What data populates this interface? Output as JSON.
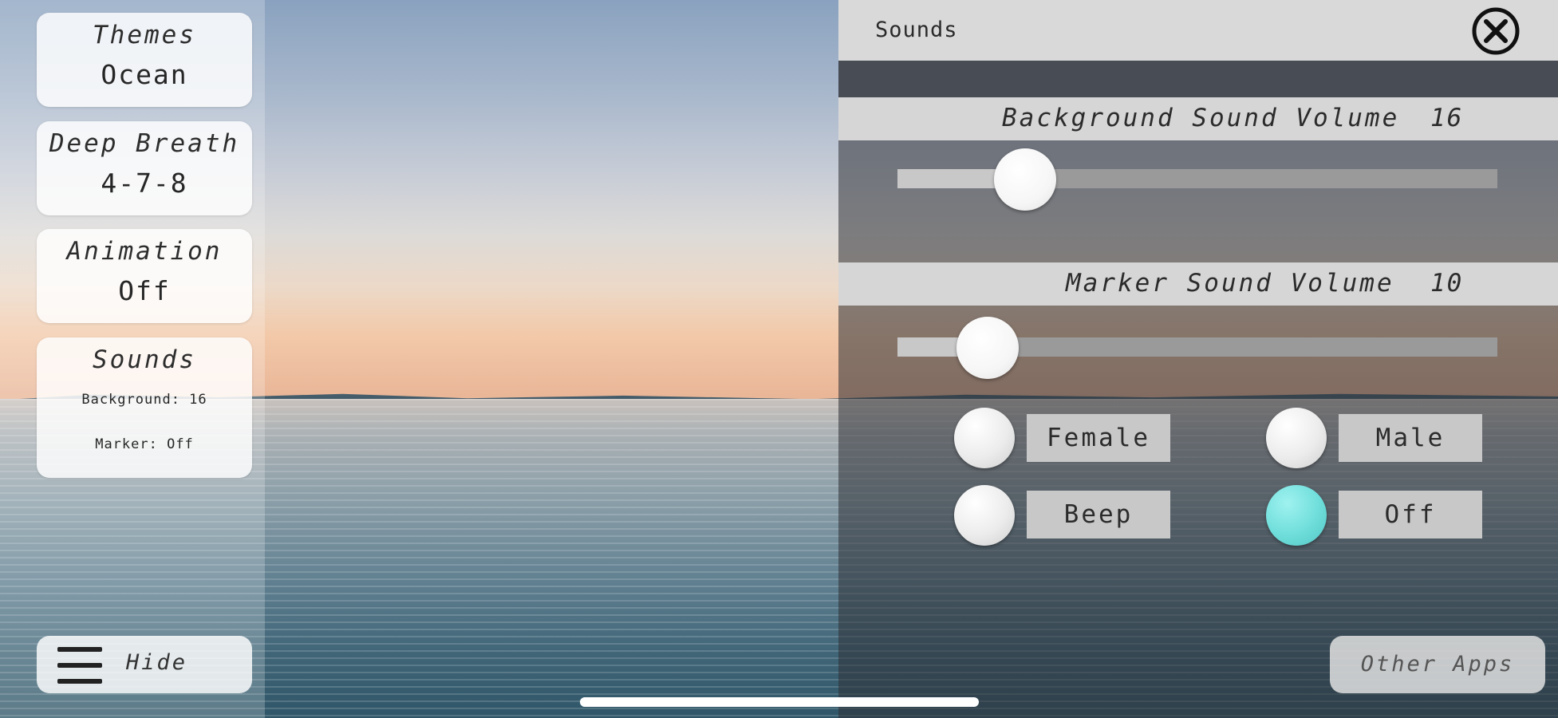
{
  "sidebar": {
    "themes": {
      "title": "Themes",
      "value": "Ocean"
    },
    "breath": {
      "title": "Deep Breath",
      "value": "4-7-8"
    },
    "animation": {
      "title": "Animation",
      "value": "Off"
    },
    "sounds": {
      "title": "Sounds",
      "background": "Background: 16",
      "marker": "Marker: Off"
    },
    "hide": {
      "label": "Hide",
      "icon": "hamburger-menu-icon"
    }
  },
  "panel": {
    "title": "Sounds",
    "close_icon": "close-circle-icon",
    "background_volume": {
      "label": "Background Sound Volume",
      "value": "16",
      "level": 0.18
    },
    "marker_volume": {
      "label": "Marker Sound Volume",
      "value": "10",
      "level": 0.11
    },
    "options": [
      {
        "label": "Female",
        "selected": false
      },
      {
        "label": "Male",
        "selected": false
      },
      {
        "label": "Beep",
        "selected": false
      },
      {
        "label": "Off",
        "selected": true
      }
    ],
    "accent_color": "#6fdedb"
  },
  "footer": {
    "other_apps": "Other Apps"
  }
}
